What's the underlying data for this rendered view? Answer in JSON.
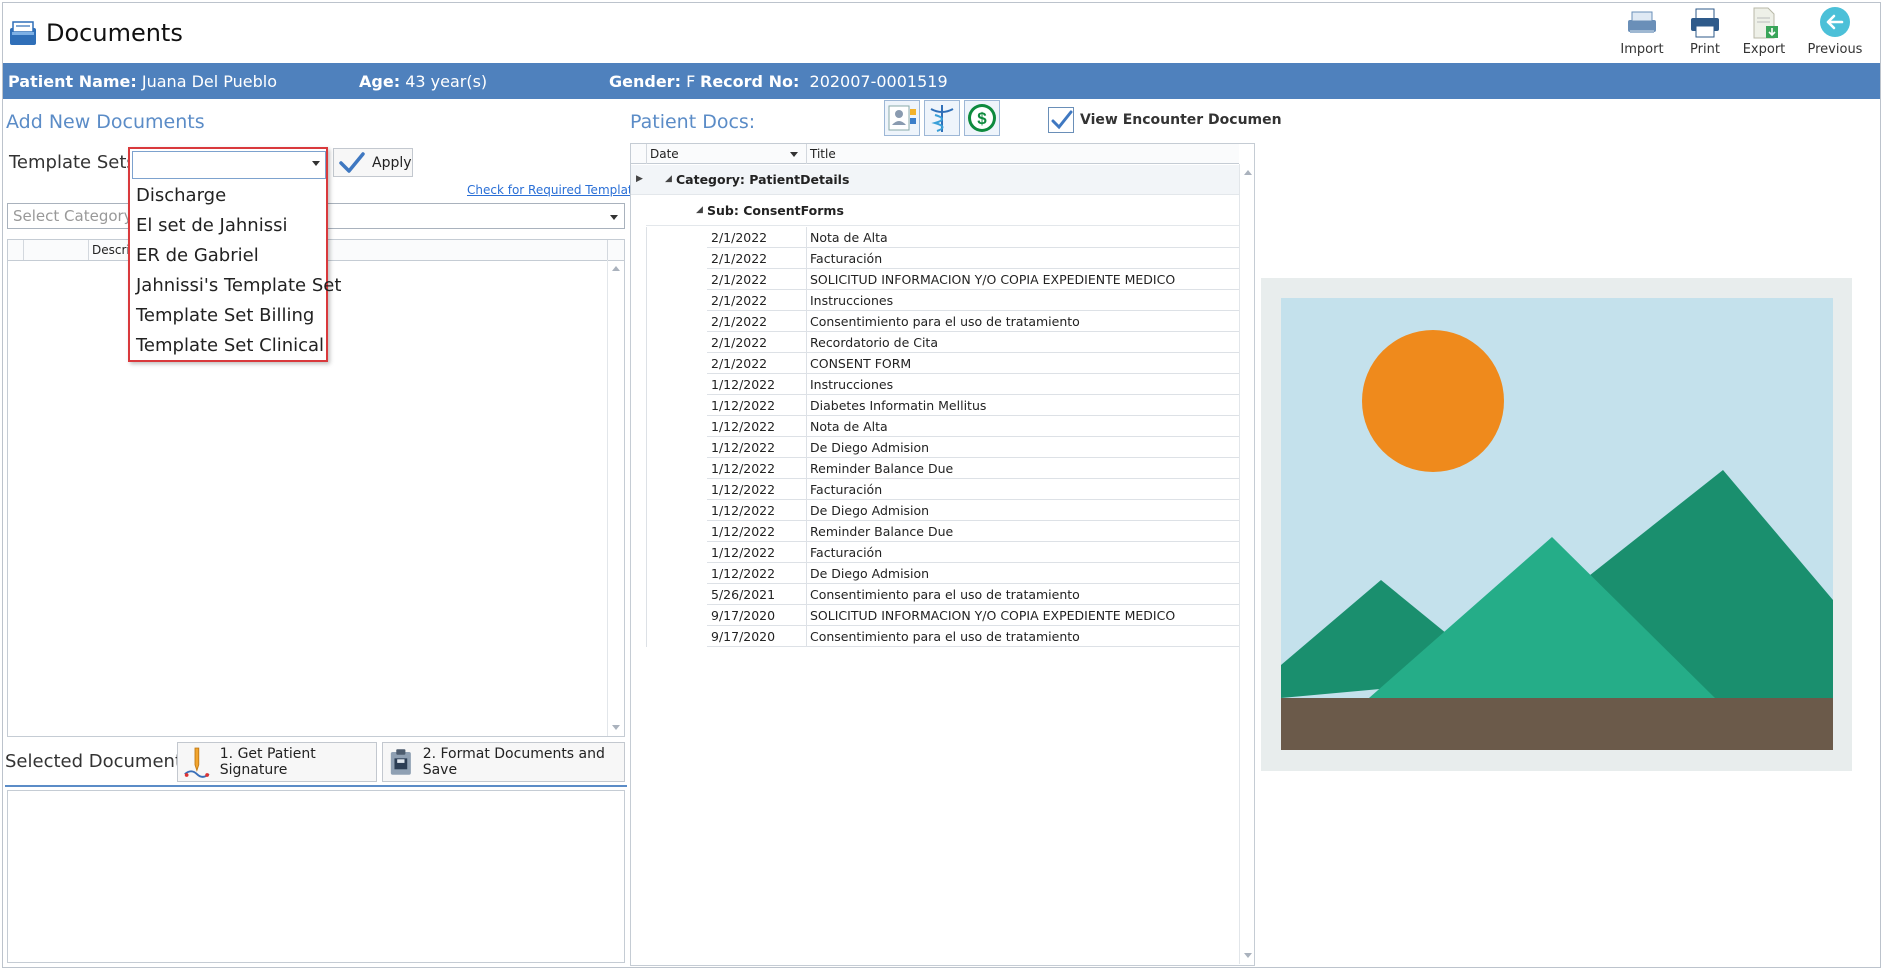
{
  "app": {
    "title": "Documents"
  },
  "toolbar": {
    "import_label": "Import",
    "print_label": "Print",
    "export_label": "Export",
    "previous_label": "Previous"
  },
  "patient": {
    "name_label": "Patient Name:",
    "name": "Juana Del Pueblo",
    "age_label": "Age:",
    "age": "43 year(s)",
    "gender_label": "Gender:",
    "gender": "F",
    "record_label": "Record No:",
    "record": "202007-0001519"
  },
  "add_docs": {
    "heading": "Add New Documents",
    "template_sets_label": "Template Sets:",
    "apply_label": "Apply",
    "required_link": "Check for Required Templates",
    "category_placeholder": "Select Category",
    "grid_header_desc": "Descrip",
    "template_options": [
      "Discharge",
      "El set de Jahnissi",
      "ER de Gabriel",
      "Jahnissi's Template Set",
      "Template Set Billing",
      "Template Set Clinical"
    ]
  },
  "selected_docs": {
    "heading": "Selected Documents",
    "signature_label": "1.  Get Patient Signature",
    "format_label": "2. Format Documents and Save"
  },
  "patient_docs": {
    "heading": "Patient Docs:",
    "view_encounter_label": "View Encounter Documen",
    "view_encounter_checked": true,
    "col_date": "Date",
    "col_title": "Title",
    "category_label": "Category: PatientDetails",
    "sub_label": "Sub: ConsentForms",
    "rows": [
      {
        "date": "2/1/2022",
        "title": "Nota de Alta"
      },
      {
        "date": "2/1/2022",
        "title": "Facturación"
      },
      {
        "date": "2/1/2022",
        "title": "SOLICITUD INFORMACION Y/O COPIA EXPEDIENTE MEDICO"
      },
      {
        "date": "2/1/2022",
        "title": "Instrucciones"
      },
      {
        "date": "2/1/2022",
        "title": "Consentimiento para el uso de tratamiento"
      },
      {
        "date": "2/1/2022",
        "title": "Recordatorio de Cita"
      },
      {
        "date": "2/1/2022",
        "title": "CONSENT FORM"
      },
      {
        "date": "1/12/2022",
        "title": "Instrucciones"
      },
      {
        "date": "1/12/2022",
        "title": "Diabetes Informatin Mellitus"
      },
      {
        "date": "1/12/2022",
        "title": "Nota de Alta"
      },
      {
        "date": "1/12/2022",
        "title": "De Diego Admision"
      },
      {
        "date": "1/12/2022",
        "title": "Reminder Balance Due"
      },
      {
        "date": "1/12/2022",
        "title": "Facturación"
      },
      {
        "date": "1/12/2022",
        "title": "De Diego Admision"
      },
      {
        "date": "1/12/2022",
        "title": "Reminder Balance Due"
      },
      {
        "date": "1/12/2022",
        "title": "Facturación"
      },
      {
        "date": "1/12/2022",
        "title": "De Diego Admision"
      },
      {
        "date": "5/26/2021",
        "title": "Consentimiento para el uso de tratamiento"
      },
      {
        "date": "9/17/2020",
        "title": "SOLICITUD INFORMACION Y/O COPIA EXPEDIENTE MEDICO"
      },
      {
        "date": "9/17/2020",
        "title": "Consentimiento para el uso de tratamiento"
      }
    ]
  },
  "colors": {
    "patient_bar": "#4f81bd",
    "heading_blue": "#5b8cc7",
    "dropdown_border": "#d9393c",
    "sun": "#ef8a1c",
    "mountain_dark": "#1a8f6e",
    "mountain_light": "#25ad88",
    "sky": "#c4e1ec",
    "ground": "#6b5a4a"
  }
}
